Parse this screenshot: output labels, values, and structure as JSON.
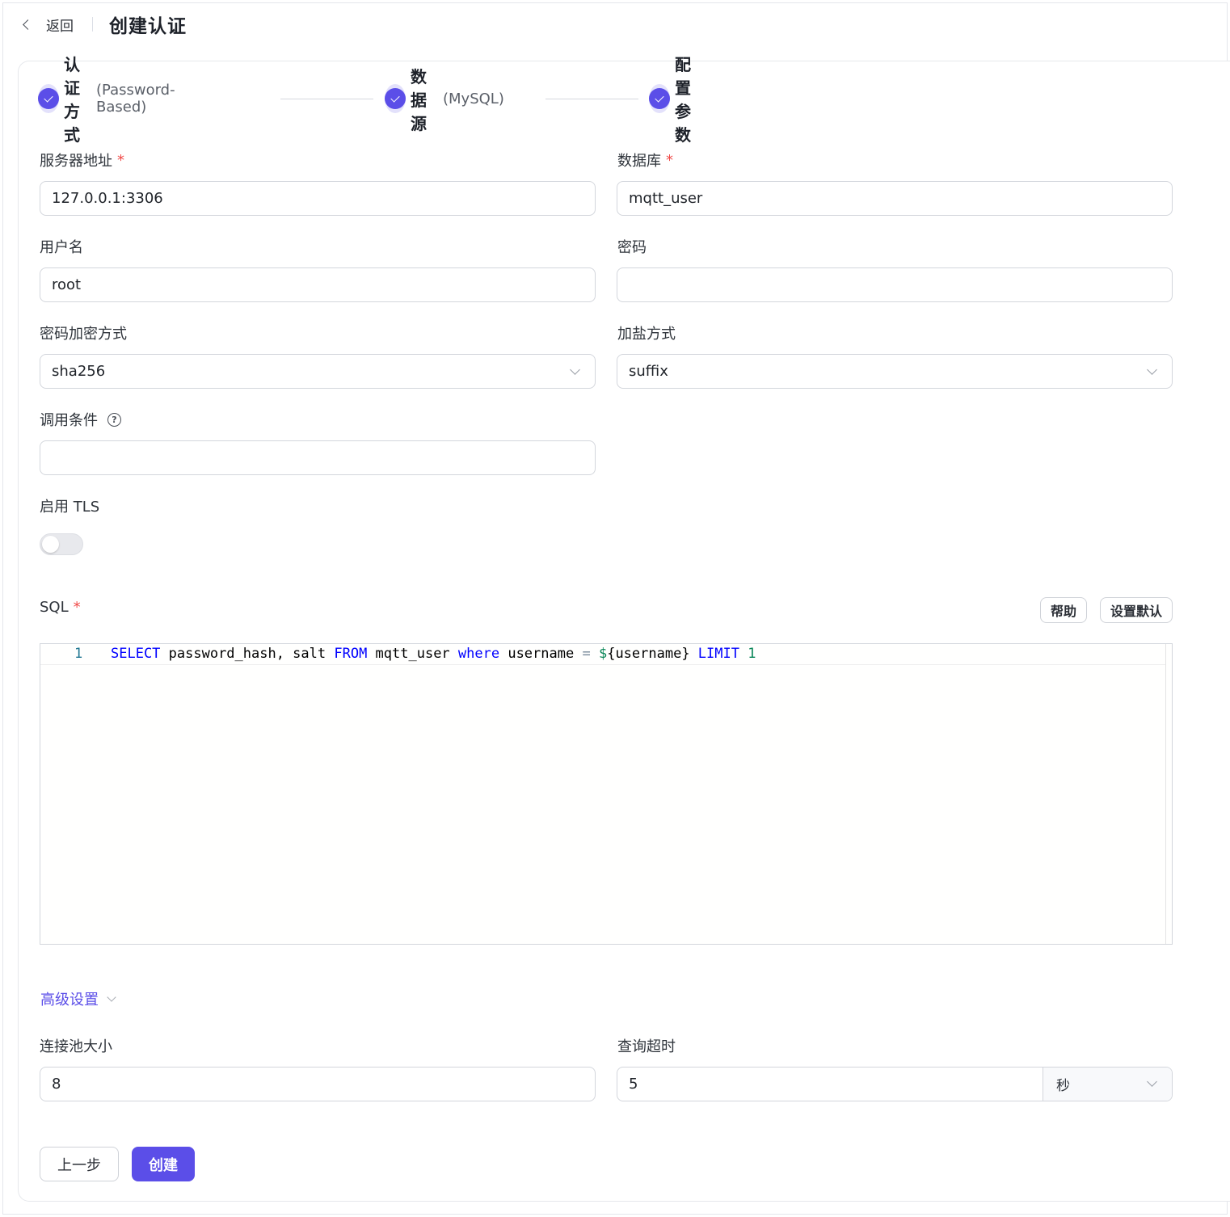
{
  "header": {
    "back_label": "返回",
    "title": "创建认证"
  },
  "steps": [
    {
      "name": "认证方式",
      "sub": "(Password-Based)"
    },
    {
      "name": "数据源",
      "sub": "(MySQL)"
    },
    {
      "name": "配置参数",
      "sub": ""
    }
  ],
  "form": {
    "server": {
      "label": "服务器地址",
      "required": "*",
      "value": "127.0.0.1:3306"
    },
    "database": {
      "label": "数据库",
      "required": "*",
      "value": "mqtt_user"
    },
    "username": {
      "label": "用户名",
      "value": "root"
    },
    "password": {
      "label": "密码",
      "value": ""
    },
    "hash": {
      "label": "密码加密方式",
      "value": "sha256"
    },
    "salt": {
      "label": "加盐方式",
      "value": "suffix"
    },
    "precondition": {
      "label": "调用条件",
      "help": "?",
      "value": ""
    },
    "tls": {
      "label": "启用 TLS",
      "enabled": false
    },
    "sql": {
      "label": "SQL",
      "required": "*",
      "help_button": "帮助",
      "default_button": "设置默认",
      "line_number": "1",
      "tokens": {
        "t1": "SELECT",
        "t2": " password_hash, salt ",
        "t3": "FROM",
        "t4": " mqtt_user ",
        "t5": "where",
        "t6": " username ",
        "t7": "=",
        "t8": " ",
        "t9": "$",
        "t10": "{username} ",
        "t11": "LIMIT",
        "t12": " ",
        "t13": "1"
      }
    },
    "advanced_label": "高级设置",
    "pool_size": {
      "label": "连接池大小",
      "value": "8"
    },
    "query_timeout": {
      "label": "查询超时",
      "value": "5",
      "unit": "秒"
    }
  },
  "actions": {
    "prev": "上一步",
    "create": "创建"
  },
  "colors": {
    "accent": "#5b4ee8",
    "required": "#f04a48"
  }
}
